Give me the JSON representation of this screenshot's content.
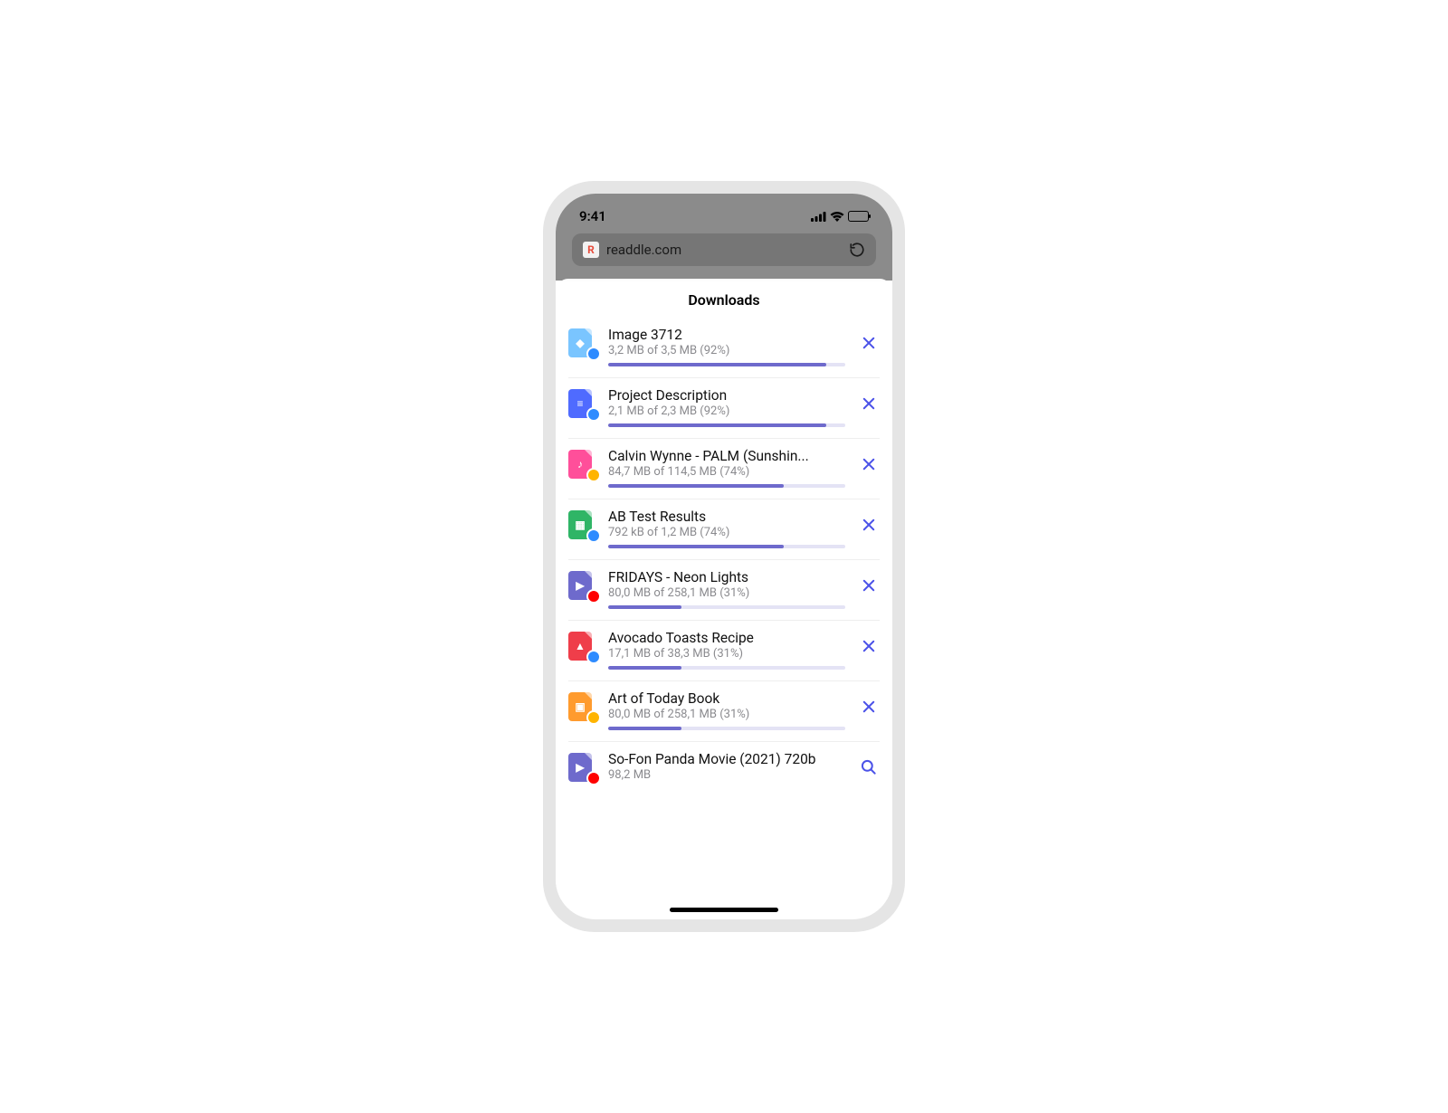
{
  "status": {
    "time": "9:41"
  },
  "addressbar": {
    "site_icon": "R",
    "url": "readdle.com"
  },
  "sheet": {
    "title": "Downloads"
  },
  "colors": {
    "image": "#7ac5ff",
    "doc": "#4f6bff",
    "music": "#ff4f9a",
    "sheet": "#2fb566",
    "video": "#6e6acc",
    "pdf": "#ef3e4a",
    "epub": "#ff9b2e",
    "safari": "#2e8bff",
    "dropbox": "#2e8bff",
    "gdrive": "#ffb400",
    "onedrive": "#2e8bff",
    "youtube": "#ff0000"
  },
  "downloads": [
    {
      "title": "Image 3712",
      "sub": "3,2 MB of 3,5 MB (92%)",
      "percent": 92,
      "icon": "image",
      "badge": "safari",
      "action": "cancel"
    },
    {
      "title": "Project Description",
      "sub": "2,1 MB of 2,3 MB (92%)",
      "percent": 92,
      "icon": "doc",
      "badge": "dropbox",
      "action": "cancel"
    },
    {
      "title": "Calvin Wynne - PALM (Sunshin...",
      "sub": "84,7 MB of 114,5 MB (74%)",
      "percent": 74,
      "icon": "music",
      "badge": "gdrive",
      "action": "cancel"
    },
    {
      "title": "AB Test Results",
      "sub": "792 kB of 1,2 MB (74%)",
      "percent": 74,
      "icon": "sheet",
      "badge": "onedrive",
      "action": "cancel"
    },
    {
      "title": "FRIDAYS - Neon Lights",
      "sub": "80,0 MB of 258,1 MB (31%)",
      "percent": 31,
      "icon": "video",
      "badge": "youtube",
      "action": "cancel"
    },
    {
      "title": "Avocado Toasts Recipe",
      "sub": "17,1 MB of 38,3 MB (31%)",
      "percent": 31,
      "icon": "pdf",
      "badge": "safari",
      "action": "cancel"
    },
    {
      "title": "Art of Today Book",
      "sub": "80,0 MB of 258,1 MB (31%)",
      "percent": 31,
      "icon": "epub",
      "badge": "gdrive",
      "action": "cancel"
    },
    {
      "title": "So-Fon Panda Movie (2021) 720b",
      "sub": "98,2 MB",
      "percent": null,
      "icon": "video",
      "badge": "youtube",
      "action": "search"
    }
  ]
}
